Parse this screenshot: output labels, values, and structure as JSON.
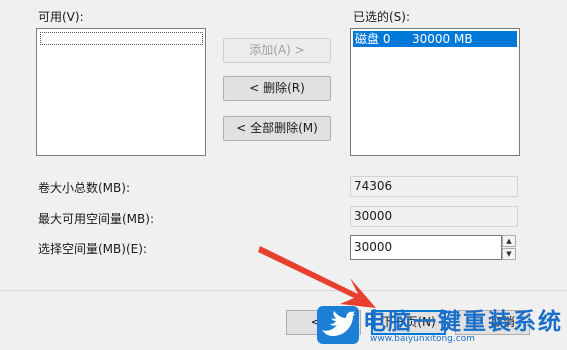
{
  "available": {
    "label": "可用(V):"
  },
  "selected": {
    "label": "已选的(S):",
    "rows": [
      {
        "name": "磁盘 0",
        "size": "30000 MB"
      }
    ]
  },
  "buttons": {
    "add": "添加(A) >",
    "remove": "< 删除(R)",
    "remove_all": "< 全部删除(M)"
  },
  "fields": {
    "total_size": {
      "label": "卷大小总数(MB):",
      "value": "74306"
    },
    "max_space": {
      "label": "最大可用空间量(MB):",
      "value": "30000"
    },
    "select_space": {
      "label": "选择空间量(MB)(E):",
      "value": "30000"
    }
  },
  "footer": {
    "back": "< 上",
    "next": "下一页(N)",
    "cancel": "取消"
  },
  "watermark": {
    "title": "电脑一键重装系统",
    "url": "www.baiyunxitong.com"
  },
  "colors": {
    "selection": "#0078d7",
    "arrow": "#e8402e",
    "watermark": "#1b7fd6"
  }
}
